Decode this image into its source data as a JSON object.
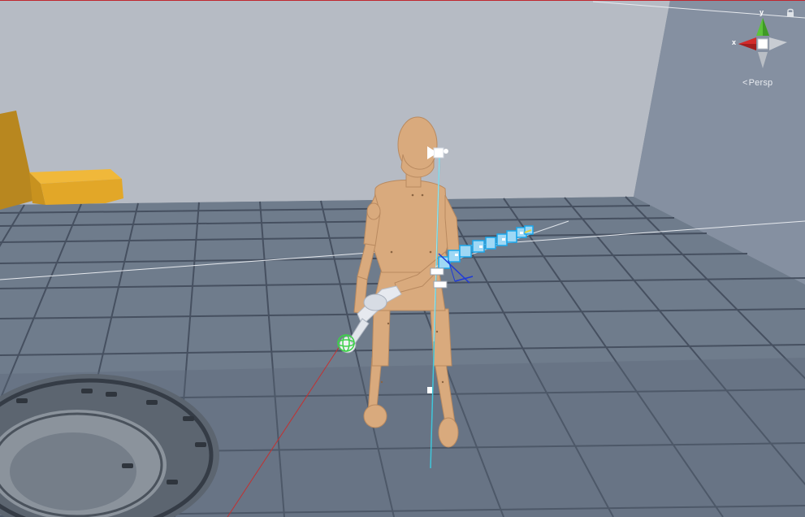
{
  "viewport": {
    "projection_label": "Persp",
    "axis_labels": {
      "x": "x",
      "y": "y"
    },
    "colors": {
      "wall": "#b4b9c2",
      "floor": "#6e7b8b",
      "floor_tile_line": "#3e4754",
      "mannequin": "#dcab7c",
      "crate": "#e0a52a",
      "axis_x": "#d22b2b",
      "axis_y": "#5cc33a",
      "selection_blue": "#1aa7ec",
      "camera_ray": "#40c4d8"
    },
    "icons": {
      "lock": "lock-icon",
      "gizmo": "orientation-gizmo-icon",
      "camera": "camera-gizmo-icon"
    }
  }
}
